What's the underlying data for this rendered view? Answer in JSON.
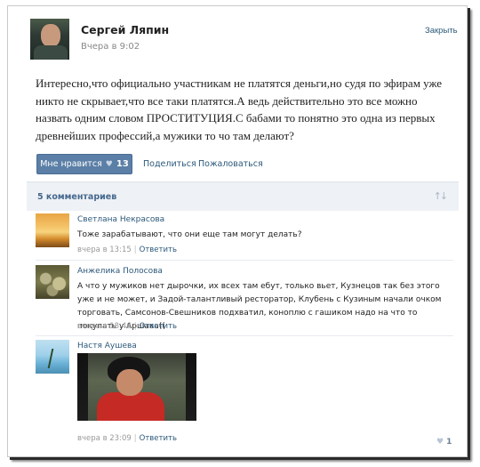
{
  "post": {
    "author": "Сергей Ляпин",
    "time": "Вчера в 9:02",
    "close_label": "Закрыть",
    "text": "Интересно,что официально участникам не платятся деньги,но судя по эфирам уже никто не скрывает,что все таки платятся.А ведь действительно это все можно назвать одним словом ПРОСТИТУЦИЯ.С бабами то понятно это одна из первых древнейших профессий,а мужики то чо там делают?",
    "like_label": "Мне нравится",
    "like_count": "13",
    "share_label": "Поделиться",
    "report_label": "Пожаловаться"
  },
  "comments_header": {
    "count_label": "5 комментариев"
  },
  "comments": [
    {
      "name": "Светлана Некрасова",
      "text": "Тоже зарабатывают, что они еще там могут делать?",
      "time": "вчера в 13:15",
      "reply": "Ответить"
    },
    {
      "name": "Анжелика Полосова",
      "text": "А что у мужиков нет дырочки, их всех там ебут, только вьет, Кузнецов так без этого уже и не может, и Задой-талантливый ресторатор, Клубень с Кузиным начали очком торговать, Самсонов-Свешников подхватил, коноплю с гашиком надо на что то покупать у Аршака((",
      "time": "вчера в 18:46",
      "reply": "Ответить"
    },
    {
      "name": "Настя Аушева",
      "text": "",
      "time": "вчера в 23:09",
      "reply": "Ответить",
      "likes": "1"
    }
  ],
  "colors": {
    "link": "#2b587a",
    "like_button": "#5b7fa6",
    "comments_bar": "#eef1f5",
    "meta": "#999999"
  },
  "icons": [
    "heart-icon",
    "sort-icon"
  ]
}
